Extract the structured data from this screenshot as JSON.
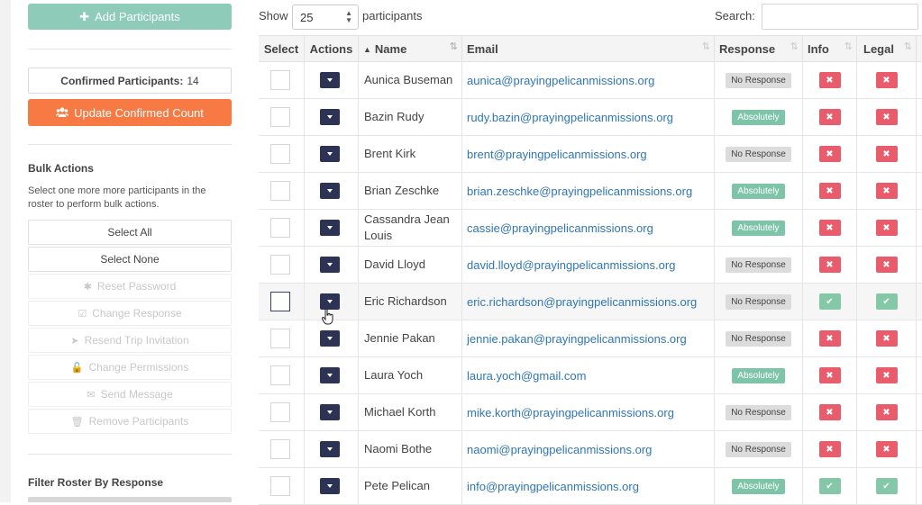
{
  "sidebar": {
    "add_button": "Add Participants",
    "confirmed_label": "Confirmed Participants:",
    "confirmed_count": "14",
    "update_button": "Update Confirmed Count",
    "bulk_title": "Bulk Actions",
    "bulk_desc": "Select one more more participants in the roster to perform bulk actions.",
    "select_all": "Select All",
    "select_none": "Select None",
    "bulk_actions": [
      {
        "label": "Reset Password",
        "icon": "asterisk-icon",
        "glyph": "✱"
      },
      {
        "label": "Change Response",
        "icon": "check-square-icon",
        "glyph": "☑"
      },
      {
        "label": "Resend Trip Invitation",
        "icon": "paper-plane-icon",
        "glyph": "➤"
      },
      {
        "label": "Change Permissions",
        "icon": "unlock-icon",
        "glyph": "🔓"
      },
      {
        "label": "Send Message",
        "icon": "envelope-icon",
        "glyph": "✉"
      },
      {
        "label": "Remove Participants",
        "icon": "trash-icon",
        "glyph": "🗑"
      }
    ],
    "filter_title": "Filter Roster By Response"
  },
  "controls": {
    "show_label": "Show",
    "page_size": "25",
    "participants_label": "participants",
    "search_label": "Search:",
    "search_value": ""
  },
  "table": {
    "headers": {
      "select": "Select",
      "actions": "Actions",
      "name": "Name",
      "email": "Email",
      "response": "Response",
      "info": "Info",
      "legal": "Legal"
    },
    "rows": [
      {
        "name": "Aunica Buseman",
        "email": "aunica@prayingpelicanmissions.org",
        "response": "No Response",
        "info": false,
        "legal": false
      },
      {
        "name": "Bazin Rudy",
        "email": "rudy.bazin@prayingpelicanmissions.org",
        "response": "Absolutely",
        "info": false,
        "legal": false
      },
      {
        "name": "Brent Kirk",
        "email": "brent@prayingpelicanmissions.org",
        "response": "No Response",
        "info": false,
        "legal": false
      },
      {
        "name": "Brian Zeschke",
        "email": "brian.zeschke@prayingpelicanmissions.org",
        "response": "Absolutely",
        "info": false,
        "legal": false
      },
      {
        "name": "Cassandra Jean Louis",
        "email": "cassie@prayingpelicanmissions.org",
        "response": "Absolutely",
        "info": false,
        "legal": false
      },
      {
        "name": "David Lloyd",
        "email": "david.lloyd@prayingpelicanmissions.org",
        "response": "No Response",
        "info": false,
        "legal": false
      },
      {
        "name": "Eric Richardson",
        "email": "eric.richardson@prayingpelicanmissions.org",
        "response": "No Response",
        "info": true,
        "legal": true
      },
      {
        "name": "Jennie Pakan",
        "email": "jennie.pakan@prayingpelicanmissions.org",
        "response": "No Response",
        "info": false,
        "legal": false
      },
      {
        "name": "Laura Yoch",
        "email": "laura.yoch@gmail.com",
        "response": "Absolutely",
        "info": false,
        "legal": false
      },
      {
        "name": "Michael Korth",
        "email": "mike.korth@prayingpelicanmissions.org",
        "response": "No Response",
        "info": false,
        "legal": false
      },
      {
        "name": "Naomi Bothe",
        "email": "naomi@prayingpelicanmissions.org",
        "response": "No Response",
        "info": false,
        "legal": false
      },
      {
        "name": "Pete Pelican",
        "email": "info@prayingpelicanmissions.org",
        "response": "Absolutely",
        "info": true,
        "legal": true
      }
    ]
  },
  "colors": {
    "add_button": "#8ecbb8",
    "update_button": "#f77a45",
    "action_button": "#2c3354",
    "email_link": "#2f76b5",
    "badge_absolutely": "#7ec4a9",
    "badge_no_response": "#dcdcdc",
    "status_no": "#e85c6c",
    "status_ok": "#84c8a8"
  }
}
